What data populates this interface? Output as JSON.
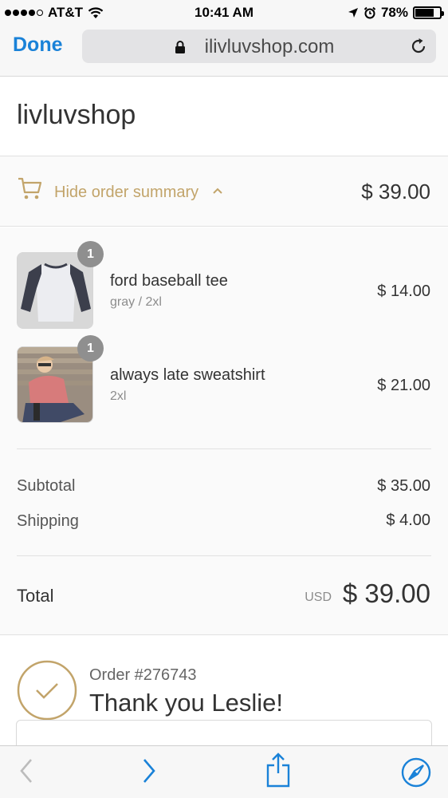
{
  "status_bar": {
    "carrier": "AT&T",
    "time": "10:41 AM",
    "battery": "78%",
    "battery_level": 0.78
  },
  "browser": {
    "done_label": "Done",
    "url": "ilivluvshop.com"
  },
  "shop": {
    "name": "livluvshop"
  },
  "summary_toggle": {
    "label": "Hide order summary",
    "total": "$ 39.00"
  },
  "products": [
    {
      "quantity": "1",
      "name": "ford baseball tee",
      "variant": "gray / 2xl",
      "price": "$ 14.00"
    },
    {
      "quantity": "1",
      "name": "always late sweatshirt",
      "variant": "2xl",
      "price": "$ 21.00"
    }
  ],
  "totals": {
    "subtotal_label": "Subtotal",
    "subtotal_value": "$ 35.00",
    "shipping_label": "Shipping",
    "shipping_value": "$ 4.00",
    "total_label": "Total",
    "currency": "USD",
    "total_value": "$ 39.00"
  },
  "confirmation": {
    "order_number": "Order #276743",
    "thank_you": "Thank you Leslie!"
  },
  "colors": {
    "accent_link": "#1a82d8",
    "gold": "#c2a46a"
  },
  "icons": {
    "lock": "lock-icon",
    "reload": "reload-icon",
    "cart": "cart-icon",
    "chevron": "chevron-up-icon",
    "check": "check-circle-icon",
    "back": "back-arrow-icon",
    "forward": "forward-arrow-icon",
    "share": "share-icon",
    "safari": "compass-icon"
  }
}
